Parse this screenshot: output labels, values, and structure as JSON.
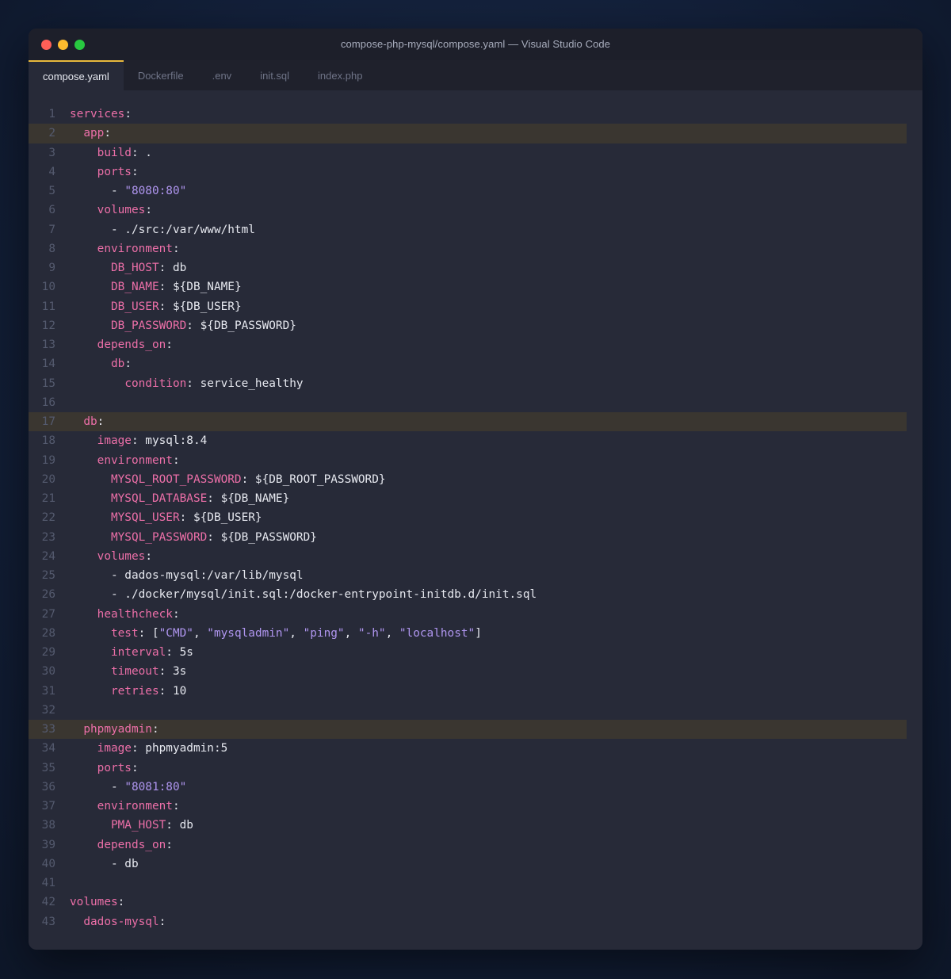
{
  "window": {
    "title": "compose-php-mysql/compose.yaml — Visual Studio Code",
    "colors": {
      "close": "#ff5f57",
      "minimize": "#febc2e",
      "maximize": "#28c840",
      "tab_accent": "#e8b93c",
      "key": "#ec6fa8",
      "string": "#b096f0",
      "highlight": "#3a3630"
    }
  },
  "tabs": [
    {
      "label": "compose.yaml",
      "active": true
    },
    {
      "label": "Dockerfile",
      "active": false
    },
    {
      "label": ".env",
      "active": false
    },
    {
      "label": "init.sql",
      "active": false
    },
    {
      "label": "index.php",
      "active": false
    }
  ],
  "editor": {
    "lines": [
      {
        "n": "1",
        "hl": false,
        "tokens": [
          [
            "k",
            "services"
          ],
          [
            "p",
            ":"
          ]
        ]
      },
      {
        "n": "2",
        "hl": true,
        "tokens": [
          [
            "p",
            "  "
          ],
          [
            "k",
            "app"
          ],
          [
            "p",
            ":"
          ]
        ]
      },
      {
        "n": "3",
        "hl": false,
        "tokens": [
          [
            "p",
            "    "
          ],
          [
            "k",
            "build"
          ],
          [
            "p",
            ": ."
          ]
        ]
      },
      {
        "n": "4",
        "hl": false,
        "tokens": [
          [
            "p",
            "    "
          ],
          [
            "k",
            "ports"
          ],
          [
            "p",
            ":"
          ]
        ]
      },
      {
        "n": "5",
        "hl": false,
        "tokens": [
          [
            "p",
            "      - "
          ],
          [
            "s",
            "\"8080:80\""
          ]
        ]
      },
      {
        "n": "6",
        "hl": false,
        "tokens": [
          [
            "p",
            "    "
          ],
          [
            "k",
            "volumes"
          ],
          [
            "p",
            ":"
          ]
        ]
      },
      {
        "n": "7",
        "hl": false,
        "tokens": [
          [
            "p",
            "      - ./src:/var/www/html"
          ]
        ]
      },
      {
        "n": "8",
        "hl": false,
        "tokens": [
          [
            "p",
            "    "
          ],
          [
            "k",
            "environment"
          ],
          [
            "p",
            ":"
          ]
        ]
      },
      {
        "n": "9",
        "hl": false,
        "tokens": [
          [
            "p",
            "      "
          ],
          [
            "k",
            "DB_HOST"
          ],
          [
            "p",
            ": db"
          ]
        ]
      },
      {
        "n": "10",
        "hl": false,
        "tokens": [
          [
            "p",
            "      "
          ],
          [
            "k",
            "DB_NAME"
          ],
          [
            "p",
            ": ${DB_NAME}"
          ]
        ]
      },
      {
        "n": "11",
        "hl": false,
        "tokens": [
          [
            "p",
            "      "
          ],
          [
            "k",
            "DB_USER"
          ],
          [
            "p",
            ": ${DB_USER}"
          ]
        ]
      },
      {
        "n": "12",
        "hl": false,
        "tokens": [
          [
            "p",
            "      "
          ],
          [
            "k",
            "DB_PASSWORD"
          ],
          [
            "p",
            ": ${DB_PASSWORD}"
          ]
        ]
      },
      {
        "n": "13",
        "hl": false,
        "tokens": [
          [
            "p",
            "    "
          ],
          [
            "k",
            "depends_on"
          ],
          [
            "p",
            ":"
          ]
        ]
      },
      {
        "n": "14",
        "hl": false,
        "tokens": [
          [
            "p",
            "      "
          ],
          [
            "k",
            "db"
          ],
          [
            "p",
            ":"
          ]
        ]
      },
      {
        "n": "15",
        "hl": false,
        "tokens": [
          [
            "p",
            "        "
          ],
          [
            "k",
            "condition"
          ],
          [
            "p",
            ": service_healthy"
          ]
        ]
      },
      {
        "n": "16",
        "hl": false,
        "tokens": []
      },
      {
        "n": "17",
        "hl": true,
        "tokens": [
          [
            "p",
            "  "
          ],
          [
            "k",
            "db"
          ],
          [
            "p",
            ":"
          ]
        ]
      },
      {
        "n": "18",
        "hl": false,
        "tokens": [
          [
            "p",
            "    "
          ],
          [
            "k",
            "image"
          ],
          [
            "p",
            ": mysql:8.4"
          ]
        ]
      },
      {
        "n": "19",
        "hl": false,
        "tokens": [
          [
            "p",
            "    "
          ],
          [
            "k",
            "environment"
          ],
          [
            "p",
            ":"
          ]
        ]
      },
      {
        "n": "20",
        "hl": false,
        "tokens": [
          [
            "p",
            "      "
          ],
          [
            "k",
            "MYSQL_ROOT_PASSWORD"
          ],
          [
            "p",
            ": ${DB_ROOT_PASSWORD}"
          ]
        ]
      },
      {
        "n": "21",
        "hl": false,
        "tokens": [
          [
            "p",
            "      "
          ],
          [
            "k",
            "MYSQL_DATABASE"
          ],
          [
            "p",
            ": ${DB_NAME}"
          ]
        ]
      },
      {
        "n": "22",
        "hl": false,
        "tokens": [
          [
            "p",
            "      "
          ],
          [
            "k",
            "MYSQL_USER"
          ],
          [
            "p",
            ": ${DB_USER}"
          ]
        ]
      },
      {
        "n": "23",
        "hl": false,
        "tokens": [
          [
            "p",
            "      "
          ],
          [
            "k",
            "MYSQL_PASSWORD"
          ],
          [
            "p",
            ": ${DB_PASSWORD}"
          ]
        ]
      },
      {
        "n": "24",
        "hl": false,
        "tokens": [
          [
            "p",
            "    "
          ],
          [
            "k",
            "volumes"
          ],
          [
            "p",
            ":"
          ]
        ]
      },
      {
        "n": "25",
        "hl": false,
        "tokens": [
          [
            "p",
            "      - dados-mysql:/var/lib/mysql"
          ]
        ]
      },
      {
        "n": "26",
        "hl": false,
        "tokens": [
          [
            "p",
            "      - ./docker/mysql/init.sql:/docker-entrypoint-initdb.d/init.sql"
          ]
        ]
      },
      {
        "n": "27",
        "hl": false,
        "tokens": [
          [
            "p",
            "    "
          ],
          [
            "k",
            "healthcheck"
          ],
          [
            "p",
            ":"
          ]
        ]
      },
      {
        "n": "28",
        "hl": false,
        "tokens": [
          [
            "p",
            "      "
          ],
          [
            "k",
            "test"
          ],
          [
            "p",
            ": ["
          ],
          [
            "s",
            "\"CMD\""
          ],
          [
            "p",
            ", "
          ],
          [
            "s",
            "\"mysqladmin\""
          ],
          [
            "p",
            ", "
          ],
          [
            "s",
            "\"ping\""
          ],
          [
            "p",
            ", "
          ],
          [
            "s",
            "\"-h\""
          ],
          [
            "p",
            ", "
          ],
          [
            "s",
            "\"localhost\""
          ],
          [
            "p",
            "]"
          ]
        ]
      },
      {
        "n": "29",
        "hl": false,
        "tokens": [
          [
            "p",
            "      "
          ],
          [
            "k",
            "interval"
          ],
          [
            "p",
            ": 5s"
          ]
        ]
      },
      {
        "n": "30",
        "hl": false,
        "tokens": [
          [
            "p",
            "      "
          ],
          [
            "k",
            "timeout"
          ],
          [
            "p",
            ": 3s"
          ]
        ]
      },
      {
        "n": "31",
        "hl": false,
        "tokens": [
          [
            "p",
            "      "
          ],
          [
            "k",
            "retries"
          ],
          [
            "p",
            ": 10"
          ]
        ]
      },
      {
        "n": "32",
        "hl": false,
        "tokens": []
      },
      {
        "n": "33",
        "hl": true,
        "tokens": [
          [
            "p",
            "  "
          ],
          [
            "k",
            "phpmyadmin"
          ],
          [
            "p",
            ":"
          ]
        ]
      },
      {
        "n": "34",
        "hl": false,
        "tokens": [
          [
            "p",
            "    "
          ],
          [
            "k",
            "image"
          ],
          [
            "p",
            ": phpmyadmin:5"
          ]
        ]
      },
      {
        "n": "35",
        "hl": false,
        "tokens": [
          [
            "p",
            "    "
          ],
          [
            "k",
            "ports"
          ],
          [
            "p",
            ":"
          ]
        ]
      },
      {
        "n": "36",
        "hl": false,
        "tokens": [
          [
            "p",
            "      - "
          ],
          [
            "s",
            "\"8081:80\""
          ]
        ]
      },
      {
        "n": "37",
        "hl": false,
        "tokens": [
          [
            "p",
            "    "
          ],
          [
            "k",
            "environment"
          ],
          [
            "p",
            ":"
          ]
        ]
      },
      {
        "n": "38",
        "hl": false,
        "tokens": [
          [
            "p",
            "      "
          ],
          [
            "k",
            "PMA_HOST"
          ],
          [
            "p",
            ": db"
          ]
        ]
      },
      {
        "n": "39",
        "hl": false,
        "tokens": [
          [
            "p",
            "    "
          ],
          [
            "k",
            "depends_on"
          ],
          [
            "p",
            ":"
          ]
        ]
      },
      {
        "n": "40",
        "hl": false,
        "tokens": [
          [
            "p",
            "      - db"
          ]
        ]
      },
      {
        "n": "41",
        "hl": false,
        "tokens": []
      },
      {
        "n": "42",
        "hl": false,
        "tokens": [
          [
            "k",
            "volumes"
          ],
          [
            "p",
            ":"
          ]
        ]
      },
      {
        "n": "43",
        "hl": false,
        "tokens": [
          [
            "p",
            "  "
          ],
          [
            "k",
            "dados-mysql"
          ],
          [
            "p",
            ":"
          ]
        ]
      }
    ]
  }
}
